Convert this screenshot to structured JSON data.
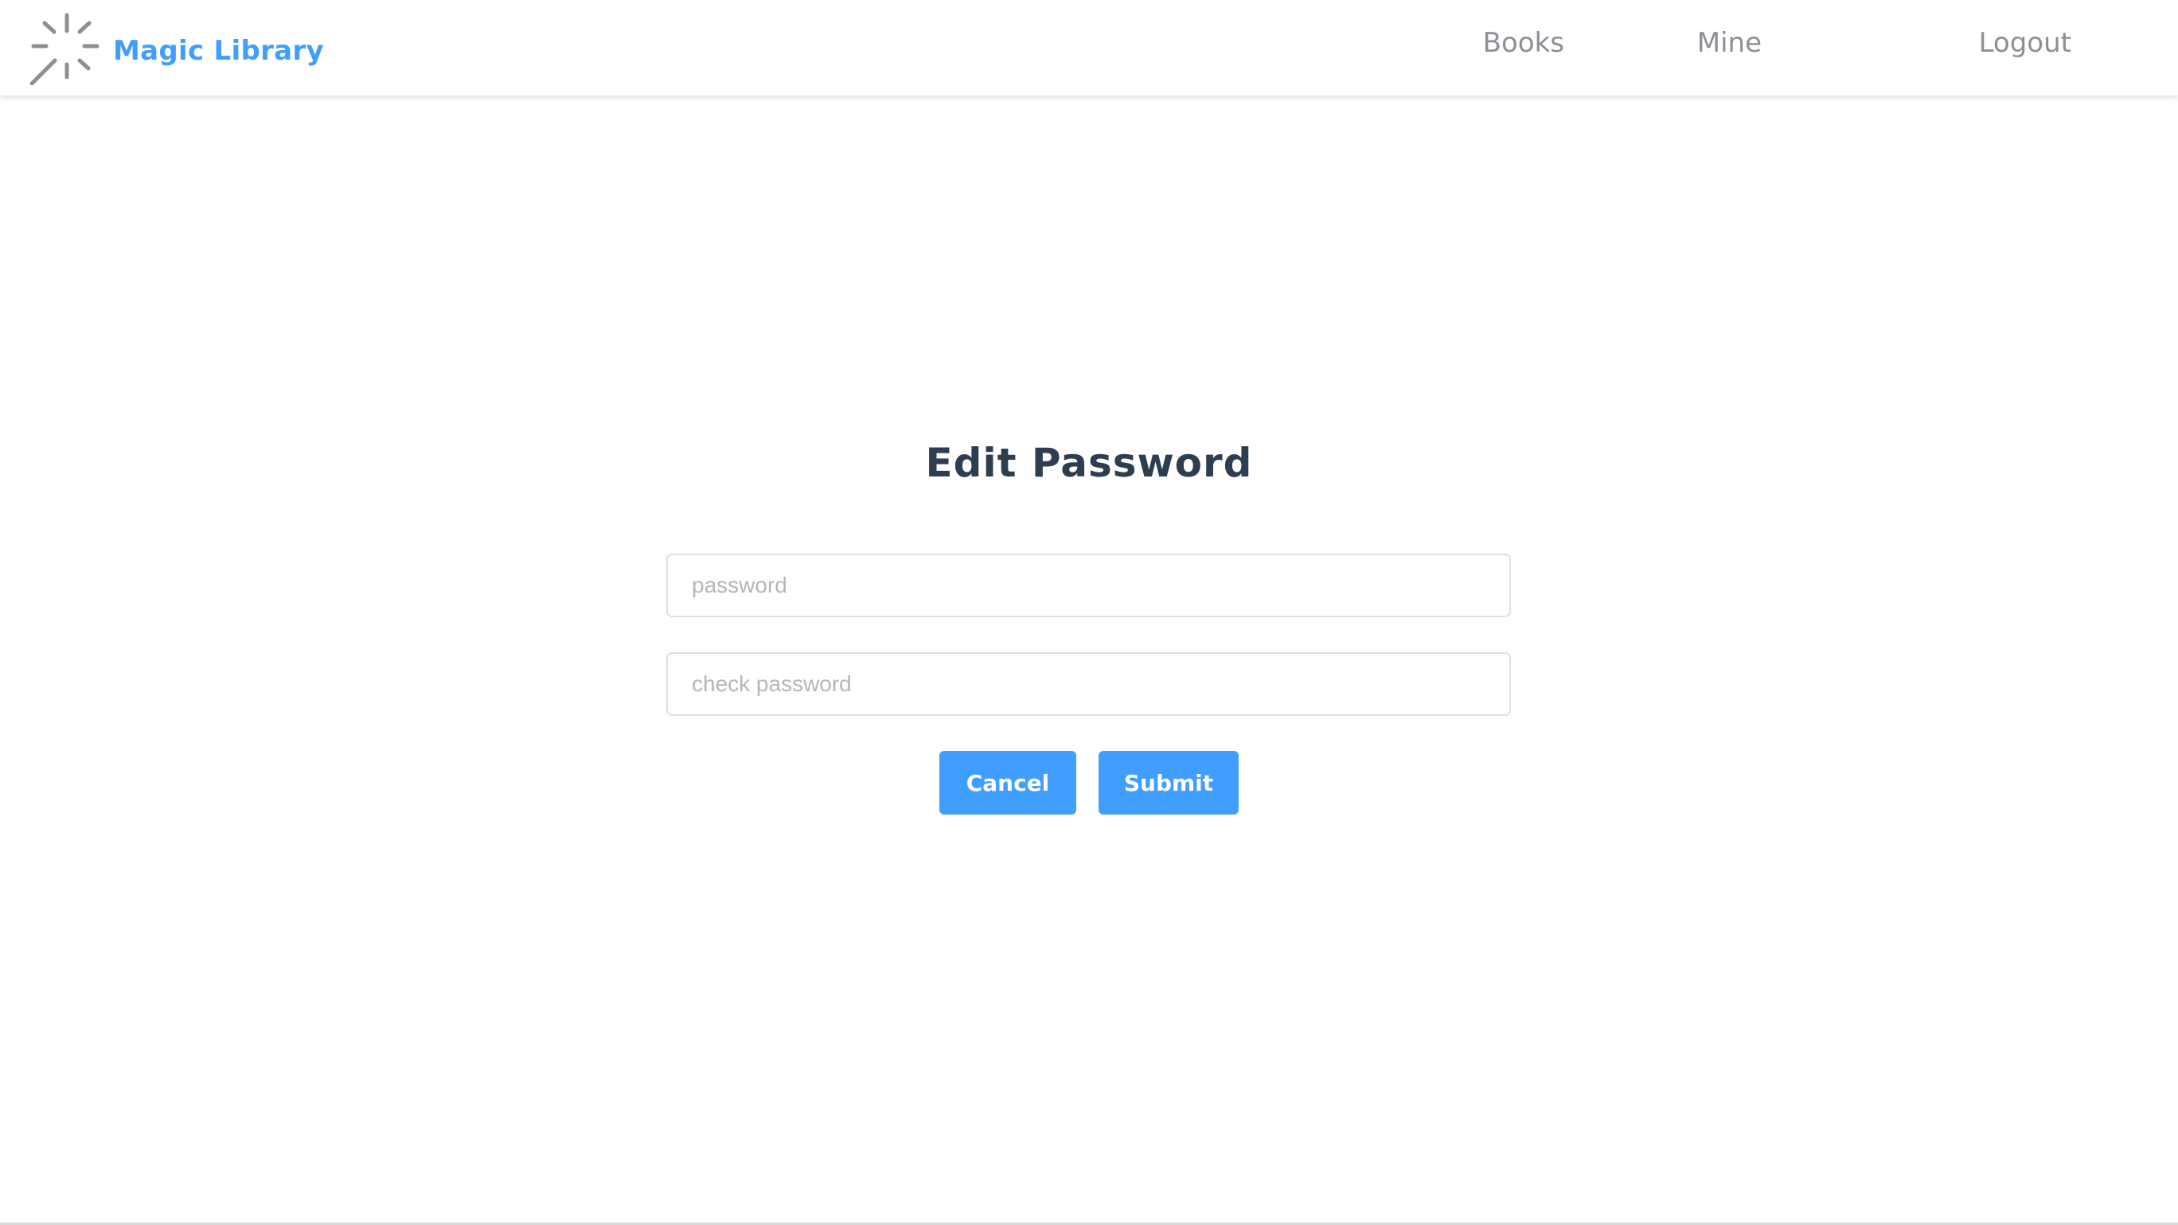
{
  "app": {
    "brand_name": "Magic Library",
    "brand_icon": "spinner-sparkle-icon",
    "accent_color": "#409eff"
  },
  "nav": {
    "items": [
      {
        "label": "Books"
      },
      {
        "label": "Mine"
      },
      {
        "label": "Logout"
      }
    ]
  },
  "form": {
    "title": "Edit Password",
    "password": {
      "value": "",
      "placeholder": "password"
    },
    "check_password": {
      "value": "",
      "placeholder": "check password"
    },
    "cancel_label": "Cancel",
    "submit_label": "Submit"
  }
}
